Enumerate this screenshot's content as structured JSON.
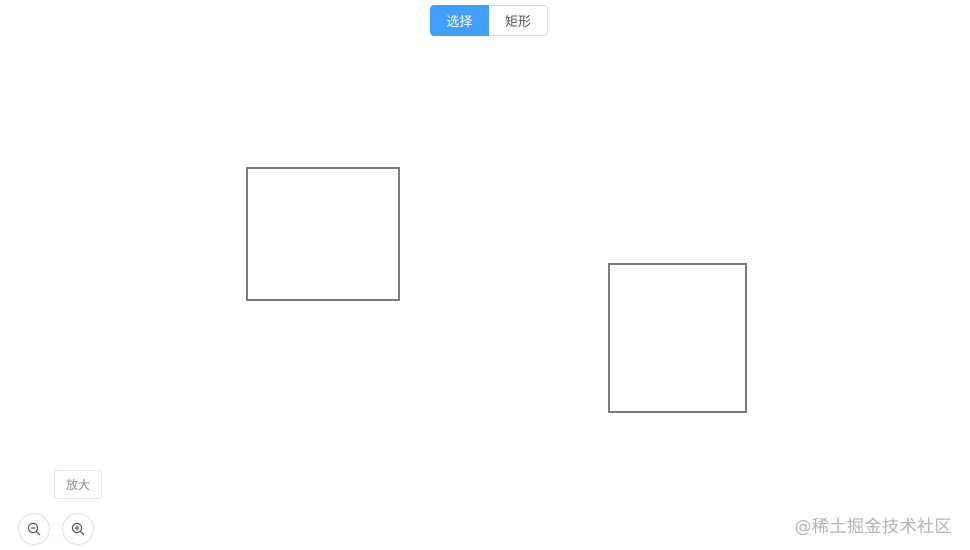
{
  "toolbar": {
    "mode_select_label": "选择",
    "mode_rect_label": "矩形",
    "active_mode": "选择"
  },
  "tooltip": {
    "text": "放大"
  },
  "zoom": {
    "zoom_out_icon": "zoom-out-icon",
    "zoom_in_icon": "zoom-in-icon"
  },
  "watermark": {
    "text": "@稀土掘金技术社区"
  },
  "colors": {
    "accent": "#409eff",
    "shape_stroke": "#7a7a7a",
    "button_border": "#dcdfe6"
  }
}
